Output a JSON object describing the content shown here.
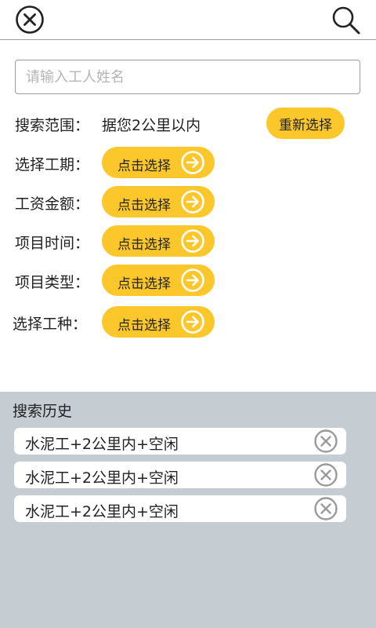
{
  "header": {
    "close_icon": "close-circle-icon",
    "search_icon": "search-icon"
  },
  "search": {
    "placeholder": "请输入工人姓名",
    "value": ""
  },
  "range": {
    "label": "搜索范围：",
    "value": "据您2公里以内",
    "reselect_label": "重新选择"
  },
  "filters": [
    {
      "label": "选择工期：",
      "button": "点击选择"
    },
    {
      "label": "工资金额：",
      "button": "点击选择"
    },
    {
      "label": "项目时间：",
      "button": "点击选择"
    },
    {
      "label": "项目类型：",
      "button": "点击选择"
    },
    {
      "label": "选择工种：",
      "button": "点击选择"
    }
  ],
  "history": {
    "title": "搜索历史",
    "items": [
      {
        "text": "水泥工+2公里内+空闲"
      },
      {
        "text": "水泥工+2公里内+空闲"
      },
      {
        "text": "水泥工+2公里内+空闲"
      }
    ]
  },
  "colors": {
    "accent": "#fcc72b",
    "history_bg": "#c6cdd2"
  }
}
